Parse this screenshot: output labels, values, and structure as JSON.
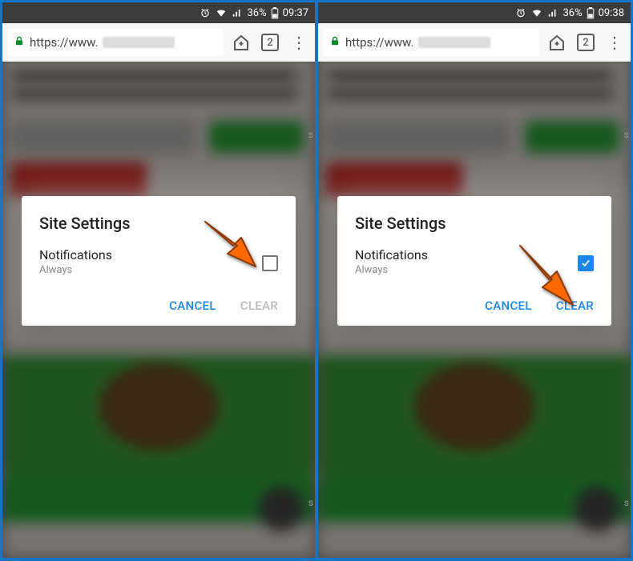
{
  "left": {
    "status": {
      "battery": "36%",
      "time": "09:37"
    },
    "toolbar": {
      "url_prefix": "https://www.",
      "tab_count": "2"
    },
    "dialog": {
      "title": "Site Settings",
      "notif_label": "Notifications",
      "notif_status": "Always",
      "checked": false,
      "cancel": "CANCEL",
      "clear": "CLEAR",
      "clear_enabled": false
    }
  },
  "right": {
    "status": {
      "battery": "36%",
      "time": "09:38"
    },
    "toolbar": {
      "url_prefix": "https://www.",
      "tab_count": "2"
    },
    "dialog": {
      "title": "Site Settings",
      "notif_label": "Notifications",
      "notif_status": "Always",
      "checked": true,
      "cancel": "CANCEL",
      "clear": "CLEAR",
      "clear_enabled": true
    }
  }
}
